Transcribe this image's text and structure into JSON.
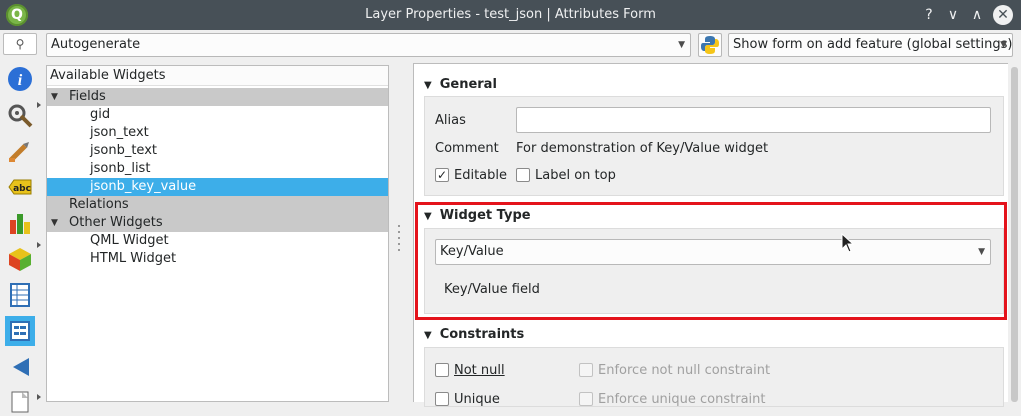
{
  "window": {
    "title": "Layer Properties - test_json | Attributes Form",
    "buttons": {
      "help": "?",
      "minimize": "∨",
      "maximize": "∧",
      "close": "✕"
    }
  },
  "sidebar": {
    "search_icon": "🔍",
    "items": [
      {
        "name": "information",
        "color": "#2b6fd6"
      },
      {
        "name": "source",
        "color": "#777777"
      },
      {
        "name": "symbology",
        "color": "#c27d2b"
      },
      {
        "name": "labels",
        "color": "#e8c21b"
      },
      {
        "name": "diagrams",
        "color": "#3a9a2a"
      },
      {
        "name": "3d-view",
        "color": "#58b030"
      },
      {
        "name": "fields",
        "color": "#2f6fb5"
      },
      {
        "name": "attributes-form",
        "color": "#2f6fb5"
      },
      {
        "name": "joins",
        "color": "#2f6fb5"
      },
      {
        "name": "auxiliary-storage",
        "color": "#666666"
      }
    ]
  },
  "toolbar": {
    "layout_combo": "Autogenerate",
    "form_combo": "Show form on add feature (global settings)"
  },
  "tree": {
    "header": "Available Widgets",
    "fields_label": "Fields",
    "fields": [
      "gid",
      "json_text",
      "jsonb_text",
      "jsonb_list",
      "jsonb_key_value"
    ],
    "relations_label": "Relations",
    "other_label": "Other Widgets",
    "other": [
      "QML Widget",
      "HTML Widget"
    ]
  },
  "general": {
    "title": "General",
    "alias_label": "Alias",
    "alias_value": "",
    "comment_label": "Comment",
    "comment_value": "For demonstration of  Key/Value widget",
    "editable_label": "Editable",
    "editable_checked": true,
    "label_on_top": "Label on top",
    "label_on_top_checked": false
  },
  "widget_type": {
    "title": "Widget Type",
    "selected": "Key/Value",
    "description": "Key/Value field"
  },
  "constraints": {
    "title": "Constraints",
    "not_null": "Not null",
    "enforce_not_null": "Enforce not null constraint",
    "unique": "Unique",
    "enforce_unique": "Enforce unique constraint"
  },
  "colors": {
    "accent": "#3daee9",
    "highlight": "#e4131b",
    "titlebar": "#475057"
  }
}
